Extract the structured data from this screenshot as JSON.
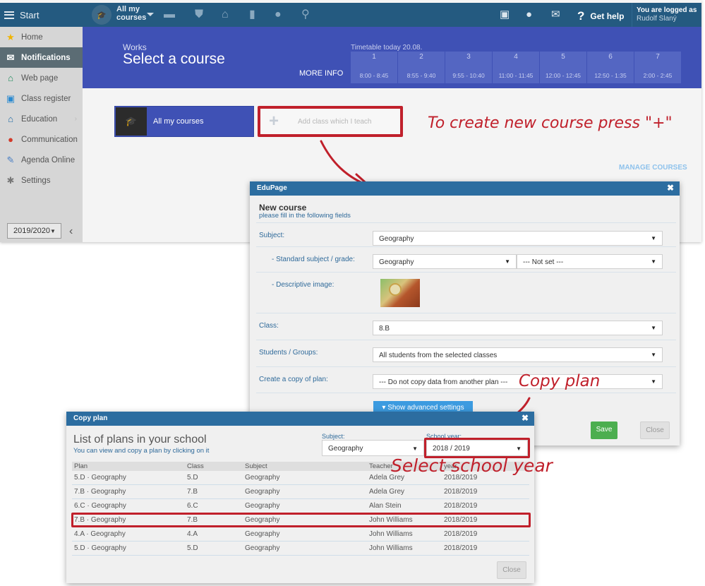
{
  "topbar": {
    "start_label": "Start",
    "course_selector_line1": "All my",
    "course_selector_line2": "courses",
    "nav_icons": [
      "briefcase-icon",
      "shield-icon",
      "bank-icon",
      "bar-chart-icon",
      "grade-icon",
      "students-icon"
    ],
    "right_icons": [
      "cast-icon",
      "chat-icon",
      "mail-icon"
    ],
    "help_label": "Get help",
    "logged_as_label": "You are logged as",
    "user_name": "Rudolf Slaný"
  },
  "sidebar": {
    "items": [
      {
        "label": "Home",
        "icon": "star-icon",
        "glyph": "★",
        "color": "#f0b400",
        "active": false,
        "chevron": false
      },
      {
        "label": "Notifications",
        "icon": "envelope-icon",
        "glyph": "✉",
        "color": "#ffffff",
        "active": true,
        "chevron": false
      },
      {
        "label": "Web page",
        "icon": "house-icon",
        "glyph": "⌂",
        "color": "#1b8a5a",
        "active": false,
        "chevron": false
      },
      {
        "label": "Class register",
        "icon": "book-icon",
        "glyph": "▣",
        "color": "#2b8ad0",
        "active": false,
        "chevron": false
      },
      {
        "label": "Education",
        "icon": "open-book-icon",
        "glyph": "⌂",
        "color": "#1f6aa5",
        "active": false,
        "chevron": true
      },
      {
        "label": "Communication",
        "icon": "chat-bubbles-icon",
        "glyph": "●",
        "color": "#d23a2a",
        "active": false,
        "chevron": true
      },
      {
        "label": "Agenda Online",
        "icon": "pen-icon",
        "glyph": "✎",
        "color": "#4a7fc4",
        "active": false,
        "chevron": false
      },
      {
        "label": "Settings",
        "icon": "gear-icon",
        "glyph": "✱",
        "color": "#777777",
        "active": false,
        "chevron": false
      }
    ],
    "school_year": "2019/2020"
  },
  "hero": {
    "section": "Works",
    "title": "Select a course",
    "more_info": "MORE INFO",
    "timetable_label": "Timetable today 20.08.",
    "periods": [
      {
        "num": "1",
        "time": "8:00 - 8:45"
      },
      {
        "num": "2",
        "time": "8:55 - 9:40"
      },
      {
        "num": "3",
        "time": "9:55 - 10:40"
      },
      {
        "num": "4",
        "time": "11:00 - 11:45"
      },
      {
        "num": "5",
        "time": "12:00 - 12:45"
      },
      {
        "num": "6",
        "time": "12:50 - 1:35"
      },
      {
        "num": "7",
        "time": "2:00 - 2:45"
      }
    ]
  },
  "courses": {
    "all_my_courses": "All my courses",
    "add_class": "Add class which I teach",
    "manage": "MANAGE COURSES"
  },
  "annotations": {
    "create": "To create new course press \"+\"",
    "copy": "Copy plan",
    "select_year": "Select school year",
    "color": "#c0202b"
  },
  "new_course_dialog": {
    "header": "EduPage",
    "title": "New course",
    "subtitle": "please fill in the following fields",
    "fields": {
      "subject_label": "Subject:",
      "subject_value": "Geography",
      "standard_label": "- Standard subject / grade:",
      "standard_value": "Geography",
      "grade_value": "--- Not set ---",
      "image_label": "- Descriptive image:",
      "class_label": "Class:",
      "class_value": "8.B",
      "students_label": "Students / Groups:",
      "students_value": "All students from the selected classes",
      "copy_label": "Create a copy of plan:",
      "copy_value": "--- Do not copy data from another plan ---"
    },
    "advanced_button": "▾  Show advanced settings",
    "save": "Save",
    "close": "Close"
  },
  "copy_plan_dialog": {
    "header": "Copy plan",
    "title": "List of plans in your school",
    "subtitle": "You can view and copy a plan by clicking on it",
    "subject_label": "Subject:",
    "subject_value": "Geography",
    "year_label": "School year:",
    "year_value": "2018 / 2019",
    "columns": [
      "Plan",
      "Class",
      "Subject",
      "Teacher",
      "year"
    ],
    "rows": [
      [
        "5.D · Geography",
        "5.D",
        "Geography",
        "Adela Grey",
        "2018/2019"
      ],
      [
        "7.B · Geography",
        "7.B",
        "Geography",
        "Adela Grey",
        "2018/2019"
      ],
      [
        "6.C · Geography",
        "6.C",
        "Geography",
        "Alan Stein",
        "2018/2019"
      ],
      [
        "7.B · Geography",
        "7.B",
        "Geography",
        "John Williams",
        "2018/2019"
      ],
      [
        "4.A · Geography",
        "4.A",
        "Geography",
        "John Williams",
        "2018/2019"
      ],
      [
        "5.D · Geography",
        "5.D",
        "Geography",
        "John Williams",
        "2018/2019"
      ]
    ],
    "highlighted_row": 3,
    "close": "Close"
  }
}
